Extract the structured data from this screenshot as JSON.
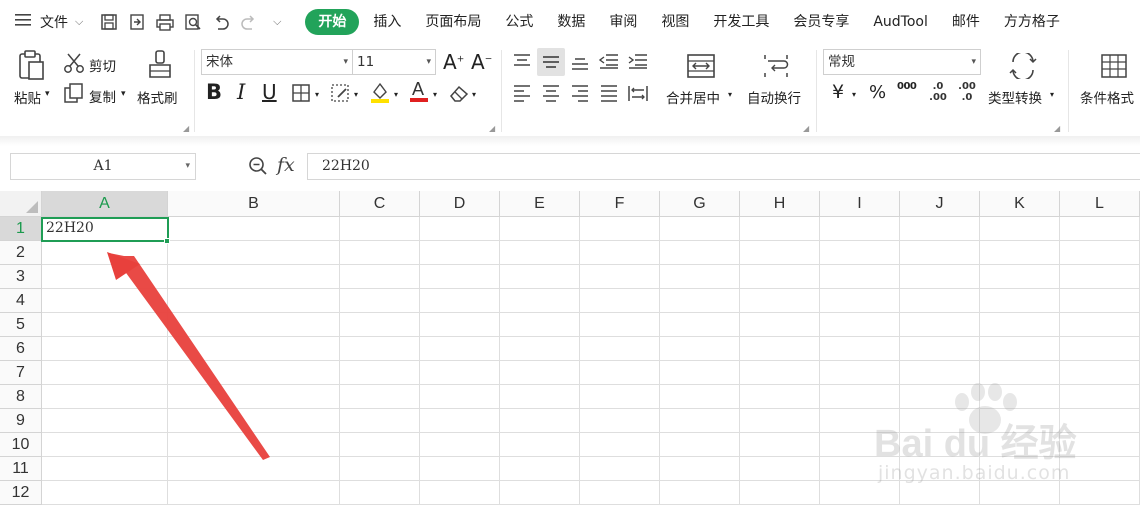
{
  "menubar": {
    "file_label": "文件",
    "tabs": [
      "开始",
      "插入",
      "页面布局",
      "公式",
      "数据",
      "审阅",
      "视图",
      "开发工具",
      "会员专享",
      "AudTool",
      "邮件",
      "方方格子"
    ],
    "active_tab": "开始"
  },
  "ribbon": {
    "paste": "粘贴",
    "cut": "剪切",
    "copy": "复制",
    "format_painter": "格式刷",
    "font_name": "宋体",
    "font_size": "11",
    "merge_center": "合并居中",
    "wrap_text": "自动换行",
    "number_format": "常规",
    "type_convert": "类型转换",
    "cond_format": "条件格式",
    "currency_symbol": "¥",
    "percent_symbol": "%",
    "thousands_symbol": "000",
    "inc_decimal": ".00",
    "dec_decimal": ".0"
  },
  "formula_bar": {
    "name_box": "A1",
    "fx": "fx",
    "formula": "22H20"
  },
  "sheet": {
    "columns": [
      "A",
      "B",
      "C",
      "D",
      "E",
      "F",
      "G",
      "H",
      "I",
      "J",
      "K",
      "L"
    ],
    "rows": [
      "1",
      "2",
      "3",
      "4",
      "5",
      "6",
      "7",
      "8",
      "9",
      "10",
      "11",
      "12"
    ],
    "cells": {
      "A1": "22H20"
    },
    "selected_cell": "A1"
  },
  "watermark": {
    "logo": "Bai du 经验",
    "url": "jingyan.baidu.com"
  },
  "colors": {
    "accent": "#22a35a",
    "selection": "#1f9d55",
    "annotation_arrow": "#e8403c"
  }
}
